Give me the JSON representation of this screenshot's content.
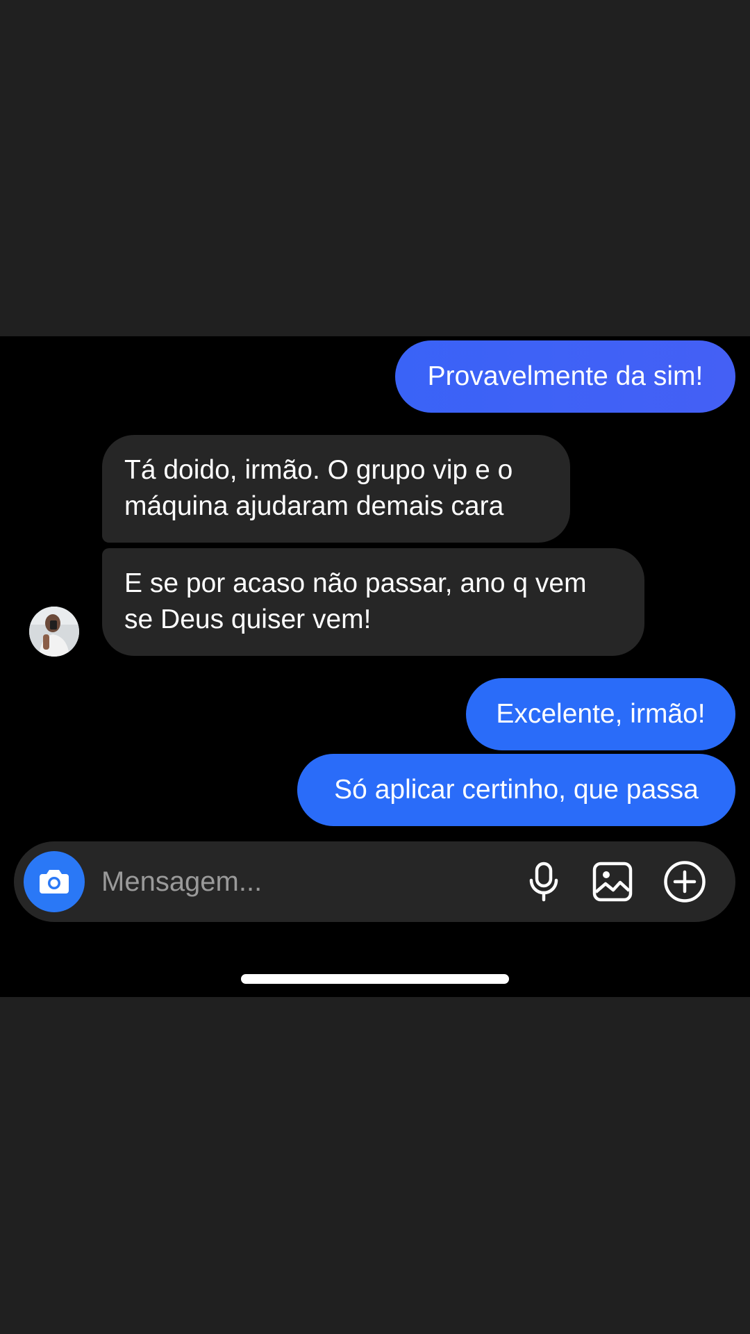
{
  "messages": [
    {
      "direction": "outgoing",
      "text": "Provavelmente da sim!"
    },
    {
      "direction": "incoming",
      "line1": "Tá doido, irmão. O grupo vip e o",
      "line2": "máquina ajudaram demais cara"
    },
    {
      "direction": "incoming",
      "line1": "E se por acaso não passar, ano q vem",
      "line2": "se Deus quiser vem!"
    },
    {
      "direction": "outgoing",
      "text": "Excelente, irmão!"
    },
    {
      "direction": "outgoing",
      "text": "Só aplicar certinho, que passa"
    }
  ],
  "composer": {
    "placeholder": "Mensagem...",
    "icons": {
      "camera": "camera-icon",
      "microphone": "microphone-icon",
      "gallery": "image-gallery-icon",
      "add": "plus-circle-icon"
    }
  },
  "colors": {
    "outgoing_bubble": "#2a6cf9",
    "incoming_bubble": "#262626",
    "camera_button": "#2a78f6",
    "screen_background": "#000000",
    "frame_background": "#202020"
  }
}
